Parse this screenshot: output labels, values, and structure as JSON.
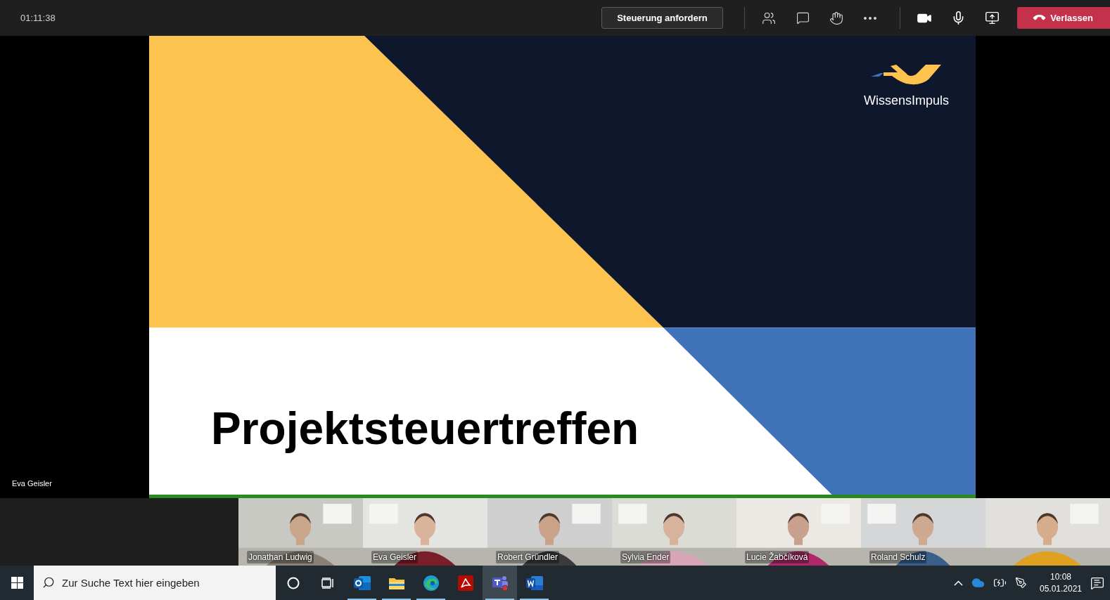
{
  "meeting_bar": {
    "timer": "01:11:38",
    "request_control_button": "Steuerung anfordern",
    "leave_button": "Verlassen"
  },
  "stage": {
    "slide": {
      "title": "Projektsteuertreffen",
      "logo_text": "WissensImpuls"
    },
    "presenter_name": "Eva Geisler"
  },
  "participants": [
    {
      "name": "Jonathan Ludwig",
      "camera_on": true
    },
    {
      "name": "Eva Geisler",
      "camera_on": true
    },
    {
      "name": "Robert Gründler",
      "camera_on": true
    },
    {
      "name": "Sylvia Ender",
      "camera_on": true
    },
    {
      "name": "Lucie Žabčíková",
      "camera_on": true
    },
    {
      "name": "Roland Schulz",
      "camera_on": true
    },
    {
      "camera_on": true
    }
  ],
  "taskbar": {
    "search": {
      "placeholder": "Zur Suche Text hier eingeben"
    },
    "apps": [
      {
        "kind": "cortana",
        "running": false,
        "selected": false
      },
      {
        "kind": "task_view",
        "running": false,
        "selected": false
      },
      {
        "kind": "outlook",
        "running": true,
        "selected": false
      },
      {
        "kind": "explorer",
        "running": true,
        "selected": false
      },
      {
        "kind": "edge",
        "running": true,
        "selected": false
      },
      {
        "kind": "acrobat",
        "running": false,
        "selected": false
      },
      {
        "kind": "teams",
        "running": true,
        "selected": true
      },
      {
        "kind": "word",
        "running": true,
        "selected": false
      }
    ],
    "clock": {
      "time": "10:08",
      "date": "05.01.2021"
    }
  }
}
